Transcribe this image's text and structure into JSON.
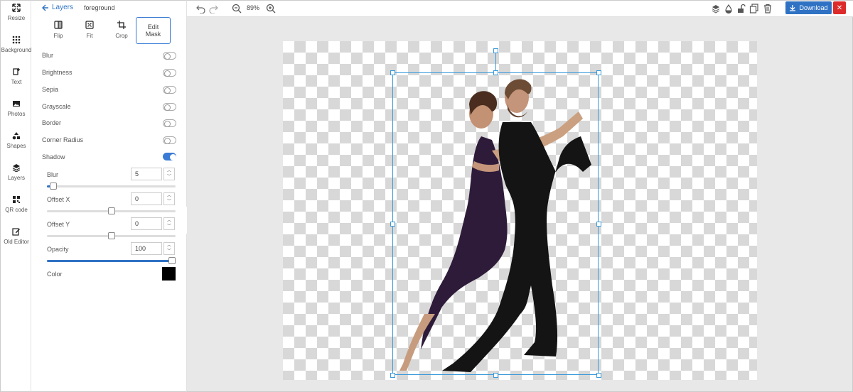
{
  "rail": {
    "items": [
      {
        "label": "Resize",
        "icon": "resize-icon"
      },
      {
        "label": "Background",
        "icon": "grid-dots-icon"
      },
      {
        "label": "Text",
        "icon": "text-icon"
      },
      {
        "label": "Photos",
        "icon": "photo-icon"
      },
      {
        "label": "Shapes",
        "icon": "shapes-icon"
      },
      {
        "label": "Layers",
        "icon": "layers-icon"
      },
      {
        "label": "QR code",
        "icon": "qr-code-icon"
      },
      {
        "label": "Old Editor",
        "icon": "edit-icon"
      }
    ]
  },
  "panel": {
    "back_label": "Layers",
    "layer_name": "foreground",
    "tools": {
      "flip": "Flip",
      "fit": "Fit",
      "crop": "Crop",
      "edit_mask_line1": "Edit",
      "edit_mask_line2": "Mask"
    },
    "effects": [
      {
        "label": "Blur",
        "on": false
      },
      {
        "label": "Brightness",
        "on": false
      },
      {
        "label": "Sepia",
        "on": false
      },
      {
        "label": "Grayscale",
        "on": false
      },
      {
        "label": "Border",
        "on": false
      },
      {
        "label": "Corner Radius",
        "on": false
      },
      {
        "label": "Shadow",
        "on": true
      }
    ],
    "shadow": {
      "blur": {
        "label": "Blur",
        "value": "5",
        "level": 0.05
      },
      "offset_x": {
        "label": "Offset X",
        "value": "0",
        "level": 0.5
      },
      "offset_y": {
        "label": "Offset Y",
        "value": "0",
        "level": 0.5
      },
      "opacity": {
        "label": "Opacity",
        "value": "100",
        "level": 1.0
      },
      "color_label": "Color",
      "color": "#000000"
    }
  },
  "topbar": {
    "zoom": "89%",
    "download_label": "Download",
    "close_label": "✕"
  },
  "colors": {
    "accent": "#2f72c4",
    "danger": "#dd2b2b",
    "selection": "#3a9ad9"
  }
}
